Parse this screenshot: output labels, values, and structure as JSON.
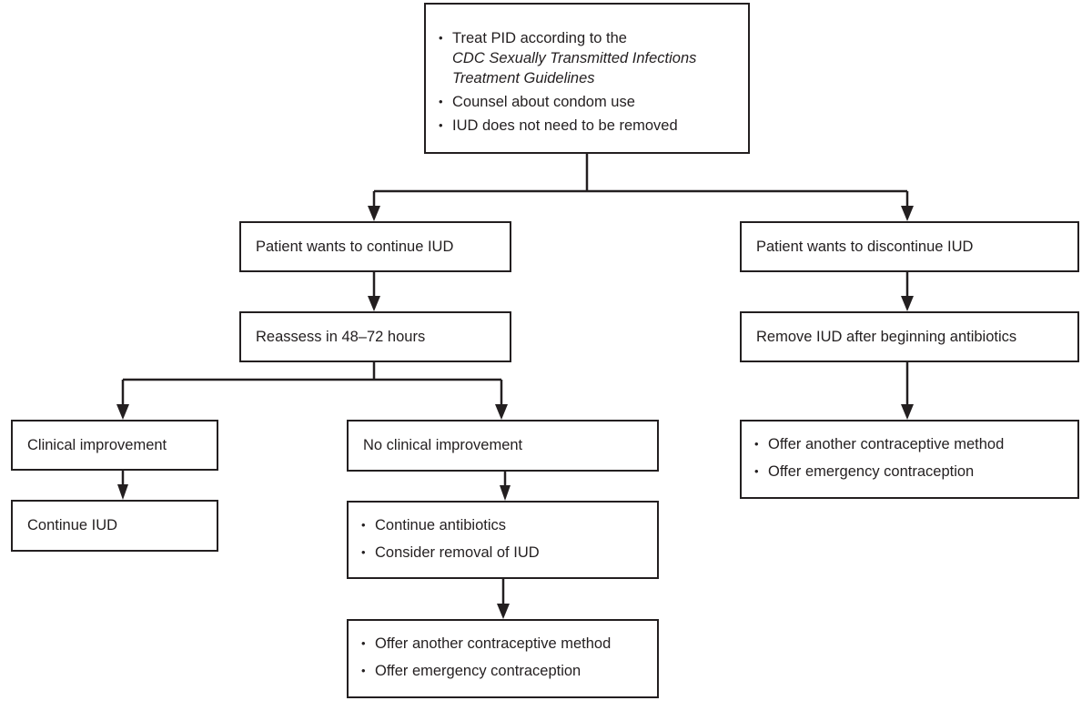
{
  "diagram": {
    "type": "flowchart",
    "nodes": {
      "top": {
        "bullets": [
          {
            "text": "Treat PID according to the",
            "italic_lines": [
              "CDC Sexually Transmitted Infections",
              "Treatment Guidelines"
            ]
          },
          {
            "text": "Counsel about condom use"
          },
          {
            "text": "IUD does not need to be removed"
          }
        ]
      },
      "continue_iud_branch": "Patient wants to continue IUD",
      "discontinue_iud_branch": "Patient wants to discontinue IUD",
      "reassess": "Reassess in 48–72 hours",
      "remove_iud": "Remove IUD after beginning antibiotics",
      "clinical_improvement": "Clinical improvement",
      "no_clinical_improvement": "No clinical improvement",
      "continue_iud": "Continue IUD",
      "no_improvement_actions": [
        "Continue antibiotics",
        "Consider removal of IUD"
      ],
      "offer_left": [
        "Offer another contraceptive method",
        "Offer emergency contraception"
      ],
      "offer_right": [
        "Offer another contraceptive method",
        "Offer emergency contraception"
      ]
    },
    "edges": [
      [
        "top",
        "continue_iud_branch"
      ],
      [
        "top",
        "discontinue_iud_branch"
      ],
      [
        "continue_iud_branch",
        "reassess"
      ],
      [
        "reassess",
        "clinical_improvement"
      ],
      [
        "reassess",
        "no_clinical_improvement"
      ],
      [
        "clinical_improvement",
        "continue_iud"
      ],
      [
        "no_clinical_improvement",
        "no_improvement_actions"
      ],
      [
        "no_improvement_actions",
        "offer_left"
      ],
      [
        "discontinue_iud_branch",
        "remove_iud"
      ],
      [
        "remove_iud",
        "offer_right"
      ]
    ]
  }
}
